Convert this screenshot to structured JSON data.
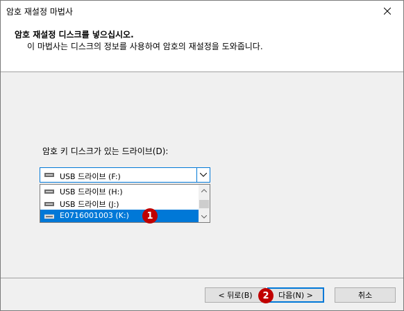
{
  "window": {
    "title": "암호 재설정 마법사"
  },
  "header": {
    "title": "암호 재설정 디스크를 넣으십시오.",
    "subtitle": "이 마법사는 디스크의 정보를 사용하여 암호의 재설정을 도와줍니다."
  },
  "drive_label": "암호 키 디스크가 있는 드라이브(D):",
  "combo": {
    "selected": "USB 드라이브 (F:)"
  },
  "list": {
    "items": [
      {
        "label": "USB 드라이브 (H:)"
      },
      {
        "label": "USB 드라이브 (J:)"
      },
      {
        "label": "E0716001003 (K:)"
      }
    ],
    "selected_index": 2
  },
  "badges": {
    "one": "1",
    "two": "2"
  },
  "buttons": {
    "back": "< 뒤로(B)",
    "next": "다음(N) >",
    "cancel": "취소"
  },
  "icons": {
    "close": "close-icon",
    "combo_arrow": "chevron-down-icon",
    "drive": "drive-icon",
    "scroll_up": "chevron-up-icon",
    "scroll_down": "chevron-down-icon"
  },
  "colors": {
    "accent": "#0078d7",
    "badge": "#c00000"
  }
}
